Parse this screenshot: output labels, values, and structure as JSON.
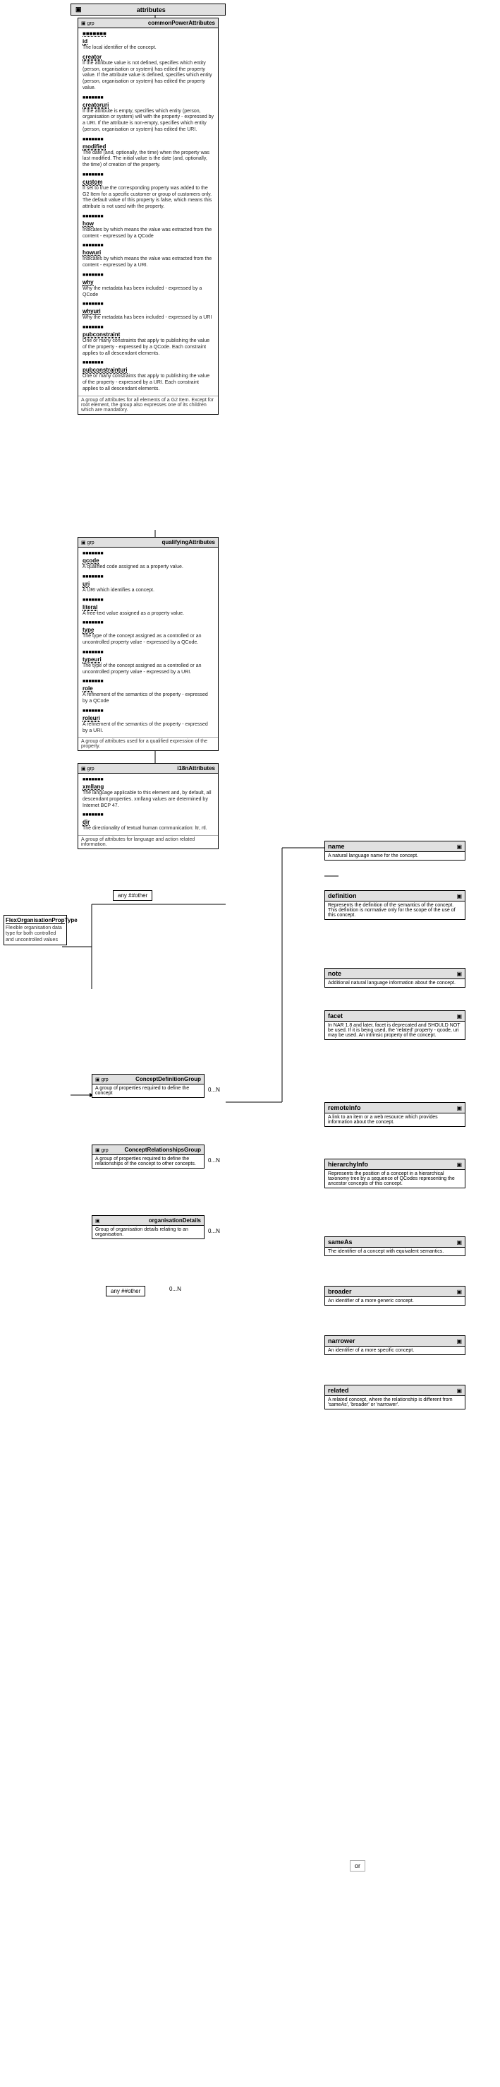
{
  "title": "attributes",
  "mainBox": {
    "stereotype": "grp",
    "name": "commonPowerAttributes",
    "sections": [
      {
        "fields": [
          {
            "name": "id",
            "desc": "The local identifier of the concept."
          },
          {
            "name": "creator",
            "desc": "If the attribute value is not defined, specifies which entity (person, organisation or system) has edited the property value. If the attribute value is defined, specifies which entity (person, organisation or system) has edited the property value."
          },
          {
            "name": "creatoruri",
            "desc": "If the attribute is empty, specifies which entity (person, organisation or system) will with the property - expressed by a URI. If the attribute is non-empty, specifies which entity (person, organisation or system) has edited the URI."
          },
          {
            "name": "modified",
            "desc": "The date (and, optionally, the time) when the property was last modified. The initial value is the date (and, optionally, the time) of creation of the property."
          },
          {
            "name": "custom",
            "desc": "If set to true the corresponding property was added to the G2 Item for a specific customer or group of customers only. The default value of this property is false, which means this attribute is not used with the property."
          },
          {
            "name": "how",
            "desc": "Indicates by which means the value was extracted from the content - expressed by a QCode"
          },
          {
            "name": "howuri",
            "desc": "Indicates by which means the value was extracted from the content - expressed by a URI."
          },
          {
            "name": "why",
            "desc": "Why the metadata has been included - expressed by a QCode"
          },
          {
            "name": "whyuri",
            "desc": "Why the metadata has been included - expressed by a URI"
          },
          {
            "name": "pubconstraint",
            "desc": "One or many constraints that apply to publishing the value of the property - expressed by a QCode. Each constraint applies to all descendant elements."
          },
          {
            "name": "pubconstrainturi",
            "desc": "One or many constraints that apply to publishing the value of the property - expressed by a URI. Each constraint applies to all descendant elements."
          }
        ]
      },
      {
        "note": "A group of attributes for all elements of a G2 Item. Except for root element, the group also expresses one of its children which are mandatory."
      }
    ]
  },
  "qualifyingBox": {
    "stereotype": "grp",
    "name": "qualifyingAttributes",
    "fields": [
      {
        "name": "qcode",
        "desc": "A qualified code assigned as a property value."
      },
      {
        "name": "uri",
        "desc": "A URI which identifies a concept."
      },
      {
        "name": "literal",
        "desc": "A free-text value assigned as a property value."
      },
      {
        "name": "type",
        "desc": "The type of the concept assigned as a controlled or an uncontrolled property value - expressed by a QCode."
      },
      {
        "name": "typeuri",
        "desc": "The type of the concept assigned as a controlled or an uncontrolled property value - expressed by a URI."
      },
      {
        "name": "role",
        "desc": "A refinement of the semantics of the property - expressed by a QCode"
      },
      {
        "name": "roleuri",
        "desc": "A refinement of the semantics of the property - expressed by a URI."
      }
    ],
    "note": "A group of attributes used for a qualified expression of the property."
  },
  "i18nBox": {
    "stereotype": "grp",
    "name": "i18nAttributes",
    "fields": [
      {
        "name": "xmllang",
        "desc": "The language applicable to this element and, by default, all descendant properties. xmllang values are determined by Internet BCP 47."
      },
      {
        "name": "dir",
        "desc": "The directionality of textual human communication: ltr, rtl."
      }
    ],
    "note": "A group of attributes for language and action related information."
  },
  "flexLabel": {
    "title": "FlexOrganisationPropType",
    "desc": "Flexible organisation data type for both controlled and uncontrolled values"
  },
  "conceptDefGroup": {
    "stereotype": "grp",
    "name": "ConceptDefinitionGroup",
    "desc": "A group of properties required to define the concept",
    "multiplicity": "0...N"
  },
  "conceptRelGroup": {
    "stereotype": "grp",
    "name": "ConceptRelationshipsGroup",
    "desc": "A group of properties required to define the relationships of the concept to other concepts.",
    "multiplicity": "0...N"
  },
  "organisationDetails": {
    "stereotype": "grp",
    "name": "organisationDetails",
    "desc": "Group of organisation details relating to an organisation.",
    "multiplicity": "0...N"
  },
  "anyOther": {
    "label": "any ##other",
    "multiplicity": "0...N"
  },
  "rightProperties": [
    {
      "name": "name",
      "desc": "A natural language name for the concept."
    },
    {
      "name": "definition",
      "desc": "Represents the definition of the semantics of the concept. This definition is normative only for the scope of the use of this concept."
    },
    {
      "name": "note",
      "desc": "Additional natural language information about the concept."
    },
    {
      "name": "facet",
      "desc": "In NAR 1.8 and later, facet is deprecated and SHOULD NOT be used. If it is being used, the 'related' property - qcode, uri may be used. An intrinsic property of the concept."
    },
    {
      "name": "remoteInfo",
      "desc": "A link to an item or a web resource which provides information about the concept."
    },
    {
      "name": "hierarchyInfo",
      "desc": "Represents the position of a concept in a hierarchical taxonomy tree by a sequence of QCodes representing the ancestor concepts of this concept."
    },
    {
      "name": "sameAs",
      "desc": "The identifier of a concept with equivalent semantics."
    },
    {
      "name": "broader",
      "desc": "An identifier of a more generic concept."
    },
    {
      "name": "narrower",
      "desc": "An identifier of a more specific concept."
    },
    {
      "name": "related",
      "desc": "A related concept, where the relationship is different from 'sameAs', 'broader' or 'narrower'."
    }
  ]
}
